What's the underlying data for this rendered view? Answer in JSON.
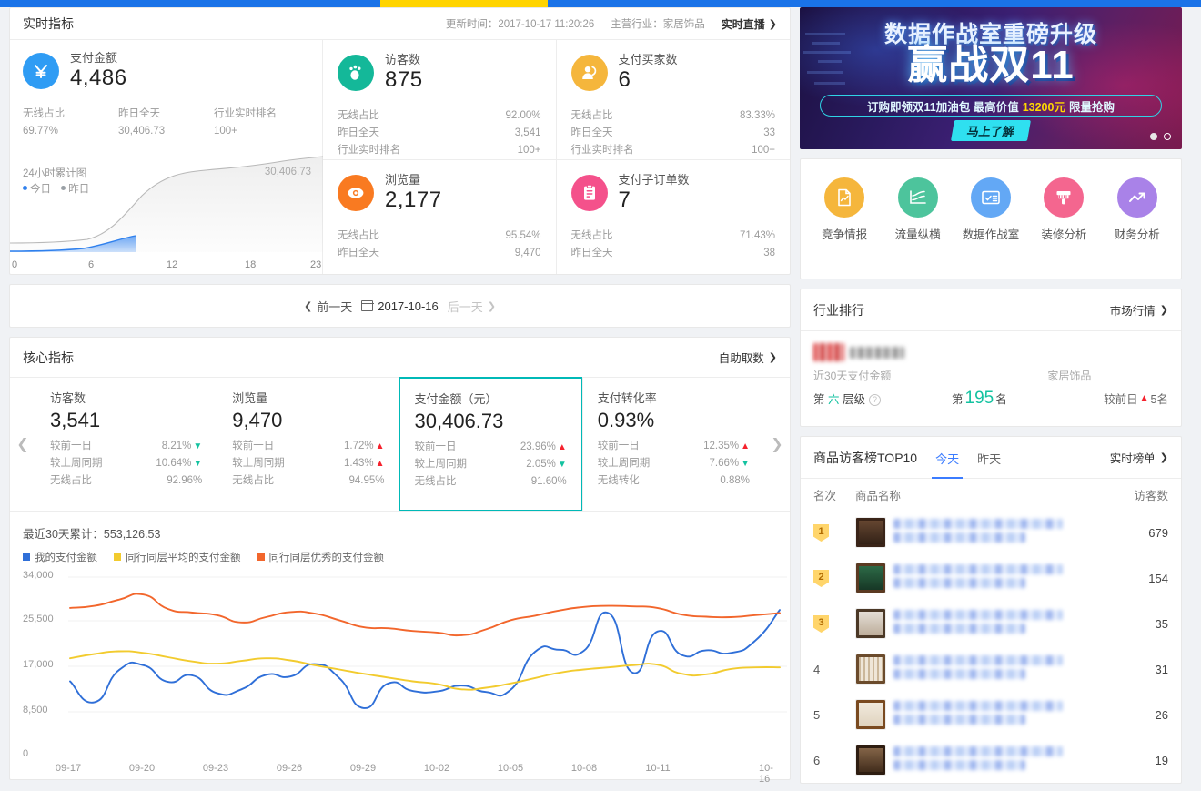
{
  "realtime": {
    "title": "实时指标",
    "update_label": "更新时间：2017-10-17 11:20:26",
    "industry_label": "主营行业：家居饰品",
    "live_link": "实时直播",
    "main": {
      "icon": "yuan-icon",
      "label": "支付金额",
      "value": "4,486",
      "color": "#2f9cf4",
      "subs": [
        {
          "k": "无线占比",
          "v": "69.77%"
        },
        {
          "k": "昨日全天",
          "v": "30,406.73"
        },
        {
          "k": "行业实时排名",
          "v": "100+"
        }
      ],
      "mini_chart_title": "24小时累计图",
      "legend_today": "今日",
      "legend_yesterday": "昨日",
      "mini_max": "30,406.73",
      "x_ticks": [
        "0",
        "6",
        "12",
        "18",
        "23"
      ]
    },
    "cells": [
      {
        "icon": "footprint-icon",
        "label": "访客数",
        "value": "875",
        "color": "#14b899",
        "subs": [
          {
            "k": "无线占比",
            "v": "92.00%"
          },
          {
            "k": "昨日全天",
            "v": "3,541"
          },
          {
            "k": "行业实时排名",
            "v": "100+"
          }
        ]
      },
      {
        "icon": "buyer-icon",
        "label": "支付买家数",
        "value": "6",
        "color": "#f5b63c",
        "subs": [
          {
            "k": "无线占比",
            "v": "83.33%"
          },
          {
            "k": "昨日全天",
            "v": "33"
          },
          {
            "k": "行业实时排名",
            "v": "100+"
          }
        ]
      },
      {
        "icon": "eye-icon",
        "label": "浏览量",
        "value": "2,177",
        "color": "#f97a21",
        "subs": [
          {
            "k": "无线占比",
            "v": "95.54%"
          },
          {
            "k": "昨日全天",
            "v": "9,470"
          }
        ]
      },
      {
        "icon": "order-icon",
        "label": "支付子订单数",
        "value": "7",
        "color": "#f4518b",
        "subs": [
          {
            "k": "无线占比",
            "v": "71.43%"
          },
          {
            "k": "昨日全天",
            "v": "38"
          }
        ]
      }
    ]
  },
  "datebar": {
    "prev": "前一天",
    "date": "2017-10-16",
    "next": "后一天"
  },
  "core": {
    "title": "核心指标",
    "self_service": "自助取数",
    "cards": [
      {
        "label": "访客数",
        "value": "3,541",
        "active": false,
        "rows": [
          {
            "k": "较前一日",
            "v": "8.21%",
            "dir": "down"
          },
          {
            "k": "较上周同期",
            "v": "10.64%",
            "dir": "down"
          },
          {
            "k": "无线占比",
            "v": "92.96%",
            "dir": "none"
          }
        ]
      },
      {
        "label": "浏览量",
        "value": "9,470",
        "active": false,
        "rows": [
          {
            "k": "较前一日",
            "v": "1.72%",
            "dir": "up"
          },
          {
            "k": "较上周同期",
            "v": "1.43%",
            "dir": "up"
          },
          {
            "k": "无线占比",
            "v": "94.95%",
            "dir": "none"
          }
        ]
      },
      {
        "label": "支付金额（元）",
        "value": "30,406.73",
        "active": true,
        "rows": [
          {
            "k": "较前一日",
            "v": "23.96%",
            "dir": "up"
          },
          {
            "k": "较上周同期",
            "v": "2.05%",
            "dir": "down"
          },
          {
            "k": "无线占比",
            "v": "91.60%",
            "dir": "none"
          }
        ]
      },
      {
        "label": "支付转化率",
        "value": "0.93%",
        "active": false,
        "rows": [
          {
            "k": "较前一日",
            "v": "12.35%",
            "dir": "up"
          },
          {
            "k": "较上周同期",
            "v": "7.66%",
            "dir": "down"
          },
          {
            "k": "无线转化",
            "v": "0.88%",
            "dir": "none"
          }
        ]
      }
    ]
  },
  "trend": {
    "summary": "最近30天累计：553,126.53"
  },
  "chart_data": {
    "type": "line",
    "title": "最近30天累计：553,126.53",
    "xlabel": "",
    "ylabel": "",
    "ylim": [
      0,
      34000
    ],
    "yticks": [
      0,
      8500,
      17000,
      25500,
      34000
    ],
    "ytick_labels": [
      "0",
      "8,500",
      "17,000",
      "25,500",
      "34,000"
    ],
    "grid": true,
    "legend_position": "top-left",
    "x": [
      "09-17",
      "09-18",
      "09-19",
      "09-20",
      "09-21",
      "09-22",
      "09-23",
      "09-24",
      "09-25",
      "09-26",
      "09-27",
      "09-28",
      "09-29",
      "09-30",
      "10-01",
      "10-02",
      "10-03",
      "10-04",
      "10-05",
      "10-06",
      "10-07",
      "10-08",
      "10-09",
      "10-10",
      "10-11",
      "10-12",
      "10-13",
      "10-14",
      "10-15",
      "10-16"
    ],
    "xtick_labels": [
      "09-17",
      "09-20",
      "09-23",
      "09-26",
      "09-29",
      "10-02",
      "10-05",
      "10-08",
      "10-11",
      "10-16"
    ],
    "series": [
      {
        "name": "我的支付金额",
        "color": "#2f6fd8",
        "values": [
          14200,
          10300,
          16300,
          17200,
          14100,
          15300,
          12000,
          12700,
          15400,
          15100,
          17400,
          14800,
          9200,
          13800,
          12400,
          12300,
          13400,
          12200,
          12600,
          19700,
          20100,
          19900,
          27000,
          15800,
          23500,
          19100,
          20000,
          19500,
          21800,
          27600
        ]
      },
      {
        "name": "同行同层平均的支付金额",
        "color": "#f2cb2e",
        "values": [
          18500,
          19300,
          19800,
          19500,
          18700,
          17900,
          17500,
          18000,
          18500,
          18100,
          17200,
          16400,
          15600,
          14900,
          14200,
          13700,
          12700,
          13000,
          13800,
          14800,
          15800,
          16400,
          16800,
          17200,
          17300,
          15600,
          15500,
          16500,
          16800,
          16800
        ]
      },
      {
        "name": "同行同层优秀的支付金额",
        "color": "#f2662c",
        "values": [
          28000,
          28400,
          29600,
          30600,
          27800,
          27100,
          26600,
          25200,
          26200,
          27200,
          26900,
          25600,
          24300,
          24100,
          23600,
          23300,
          22800,
          23900,
          25600,
          26500,
          27500,
          28200,
          28400,
          28300,
          28000,
          26700,
          26300,
          26200,
          26600,
          27000
        ]
      }
    ]
  },
  "banner": {
    "title_line1": "数据作战室重磅升级",
    "title_line2": "赢战双11",
    "subtitle_pre": "订购即领双11加油包 最高价值",
    "subtitle_highlight": "13200元",
    "subtitle_post": "限量抢购",
    "button": "马上了解"
  },
  "quick_links": [
    {
      "label": "竞争情报",
      "icon": "report-icon",
      "color": "#f5b63c"
    },
    {
      "label": "流量纵横",
      "icon": "traffic-chart-icon",
      "color": "#4dc49c"
    },
    {
      "label": "数据作战室",
      "icon": "dashboard-card-icon",
      "color": "#63a8f5"
    },
    {
      "label": "装修分析",
      "icon": "paintbrush-icon",
      "color": "#f4668f"
    },
    {
      "label": "财务分析",
      "icon": "trend-up-icon",
      "color": "#a982e8"
    }
  ],
  "industry_rank": {
    "title": "行业排行",
    "link": "市场行情",
    "metric_label": "近30天支付金额",
    "category": "家居饰品",
    "tier_prefix": "第",
    "tier_value": "六",
    "tier_suffix": "层级",
    "rank_prefix": "第",
    "rank_value": "195",
    "rank_suffix": "名",
    "compare_label": "较前日",
    "compare_value": "5名",
    "compare_dir": "up"
  },
  "top10": {
    "title": "商品访客榜TOP10",
    "tabs": [
      {
        "label": "今天",
        "active": true
      },
      {
        "label": "昨天",
        "active": false
      }
    ],
    "link": "实时榜单",
    "columns": [
      "名次",
      "商品名称",
      "访客数"
    ],
    "rows": [
      {
        "rank": "1",
        "medal": true,
        "visitors": "679"
      },
      {
        "rank": "2",
        "medal": true,
        "visitors": "154"
      },
      {
        "rank": "3",
        "medal": true,
        "visitors": "35"
      },
      {
        "rank": "4",
        "medal": false,
        "visitors": "31"
      },
      {
        "rank": "5",
        "medal": false,
        "visitors": "26"
      },
      {
        "rank": "6",
        "medal": false,
        "visitors": "19"
      }
    ]
  }
}
